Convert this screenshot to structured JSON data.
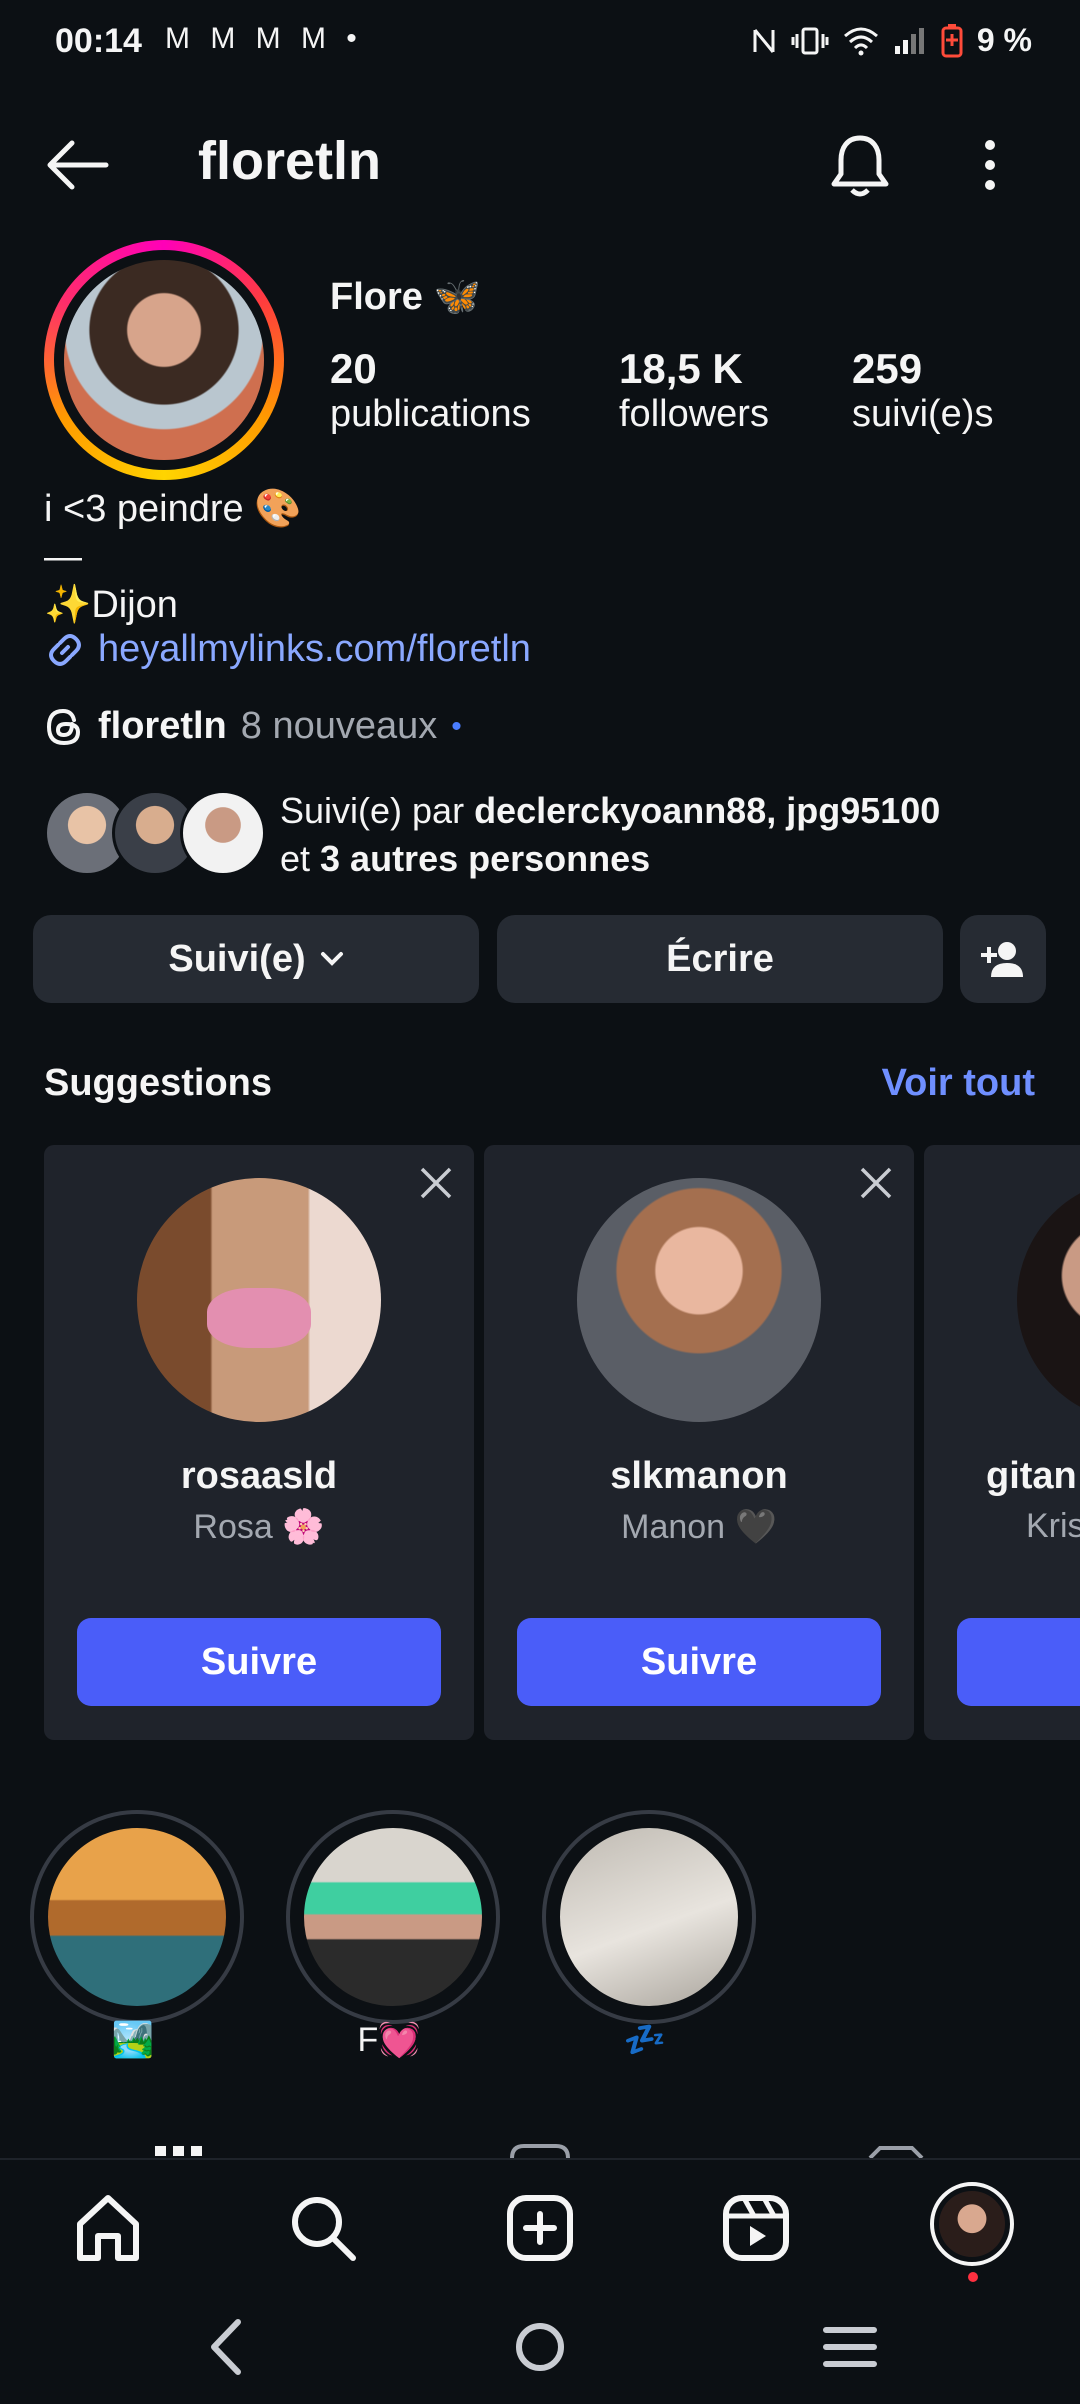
{
  "status_bar": {
    "time": "00:14",
    "notif_icons": "M M M M •",
    "battery": "9 %"
  },
  "header": {
    "username": "floretln"
  },
  "profile": {
    "display_name": "Flore 🦋",
    "stats": [
      {
        "value": "20",
        "label": "publications"
      },
      {
        "value": "18,5 K",
        "label": "followers"
      },
      {
        "value": "259",
        "label": "suivi(e)s"
      }
    ],
    "bio_lines": [
      "i <3 peindre 🎨",
      "—",
      "✨Dijon"
    ],
    "link": "heyallmylinks.com/floretln",
    "threads_handle": "floretln",
    "threads_new": "8 nouveaux",
    "followed_by_prefix": "Suivi(e) par ",
    "followed_by_names": "declerckyoann88, jpg95100",
    "followed_by_and": "et ",
    "followed_by_others": "3 autres personnes"
  },
  "actions": {
    "following": "Suivi(e)",
    "message": "Écrire"
  },
  "suggestions": {
    "title": "Suggestions",
    "see_all": "Voir tout",
    "cards": [
      {
        "username": "rosaasld",
        "name": "Rosa 🌸",
        "button": "Suivre"
      },
      {
        "username": "slkmanon",
        "name": "Manon 🖤",
        "button": "Suivre"
      },
      {
        "username": "gitan",
        "name": "Kris",
        "button": ""
      }
    ]
  },
  "highlights": [
    {
      "label": "🏞️"
    },
    {
      "label": "F💓"
    },
    {
      "label": "💤"
    }
  ],
  "colors": {
    "background": "#0c1014",
    "accent_link": "#8aa8ff",
    "follow_button": "#4a5df9",
    "card_bg": "#1f232b"
  }
}
